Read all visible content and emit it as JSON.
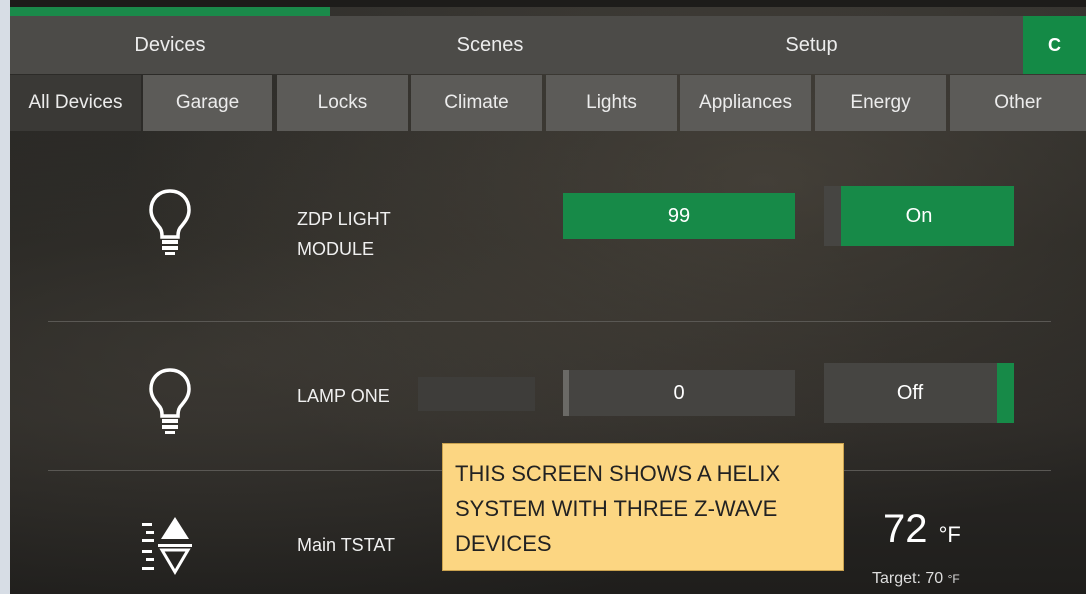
{
  "nav": {
    "tabs": [
      "Devices",
      "Scenes",
      "Setup"
    ],
    "refresh_icon": "refresh-icon",
    "refresh_glyph": "C"
  },
  "subnav": {
    "tabs": [
      "All Devices",
      "Garage",
      "Locks",
      "Climate",
      "Lights",
      "Appliances",
      "Energy",
      "Other"
    ],
    "active": "All Devices"
  },
  "devices": [
    {
      "icon": "lightbulb-icon",
      "name_line1": "ZDP LIGHT",
      "name_line2": "MODULE",
      "level": "99",
      "state": "On"
    },
    {
      "icon": "lightbulb-icon",
      "name": "LAMP ONE",
      "level": "0",
      "state": "Off"
    },
    {
      "icon": "thermostat-icon",
      "name": "Main TSTAT",
      "temperature": "72",
      "unit": "°F",
      "target_label": "Target: 70",
      "target_unit": "°F"
    }
  ],
  "callout": {
    "lines": [
      "THIS SCREEN SHOWS A HELIX",
      "SYSTEM WITH THREE Z-WAVE",
      "DEVICES"
    ]
  },
  "colors": {
    "accent": "#148a46",
    "callout": "#fcd682",
    "nav": "#4c4b48"
  }
}
